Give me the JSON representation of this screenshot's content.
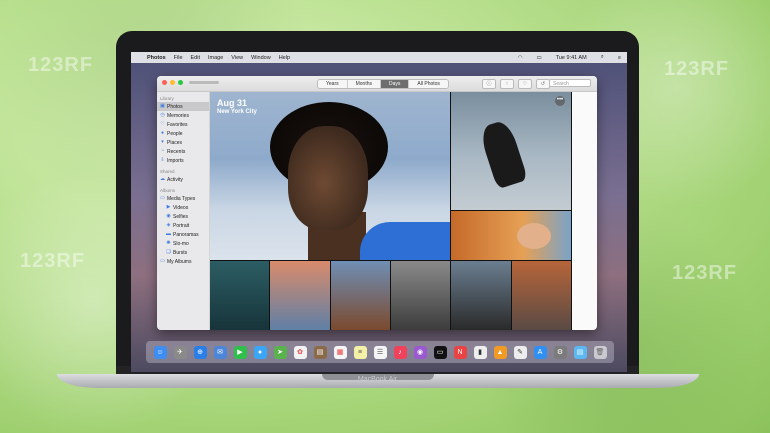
{
  "menubar": {
    "apple": "",
    "app_name": "Photos",
    "items": [
      "File",
      "Edit",
      "Image",
      "View",
      "Window",
      "Help"
    ],
    "clock": "Tue 9:41 AM"
  },
  "toolbar": {
    "segments": [
      "Years",
      "Months",
      "Days",
      "All Photos"
    ],
    "active_segment": "Days",
    "search_placeholder": "Search"
  },
  "sidebar": {
    "library_header": "Library",
    "library_items": [
      {
        "label": "Photos",
        "icon": "photos-icon",
        "selected": true
      },
      {
        "label": "Memories",
        "icon": "memories-icon"
      },
      {
        "label": "Favorites",
        "icon": "heart-icon"
      },
      {
        "label": "People",
        "icon": "person-icon"
      },
      {
        "label": "Places",
        "icon": "pin-icon"
      },
      {
        "label": "Recents",
        "icon": "clock-icon"
      },
      {
        "label": "Imports",
        "icon": "import-icon"
      }
    ],
    "shared_header": "Shared",
    "shared_items": [
      {
        "label": "Activity",
        "icon": "cloud-icon"
      }
    ],
    "albums_header": "Albums",
    "album_items": [
      {
        "label": "Media Types",
        "icon": "folder-icon"
      },
      {
        "label": "Videos",
        "icon": "video-icon"
      },
      {
        "label": "Selfies",
        "icon": "selfie-icon"
      },
      {
        "label": "Portrait",
        "icon": "cube-icon"
      },
      {
        "label": "Panoramas",
        "icon": "panorama-icon"
      },
      {
        "label": "Slo-mo",
        "icon": "slomo-icon"
      },
      {
        "label": "Bursts",
        "icon": "burst-icon"
      },
      {
        "label": "My Albums",
        "icon": "folder-icon"
      }
    ]
  },
  "main": {
    "date": "Aug 31",
    "location": "New York City",
    "more_button": "•••"
  },
  "laptop": {
    "brand": "MacBook Air"
  },
  "watermark": "123RF",
  "colors": {
    "accent": "#3a7ce2",
    "background": "#b9e08f"
  }
}
